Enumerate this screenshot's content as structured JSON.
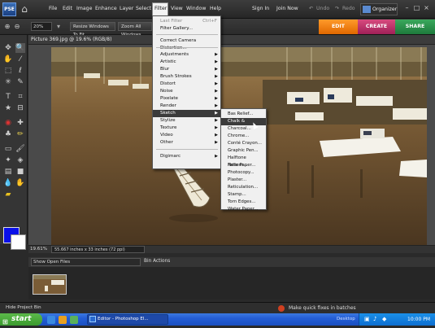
{
  "menubar": {
    "app_logo": "PSE",
    "menus": [
      "File",
      "Edit",
      "Image",
      "Enhance",
      "Layer",
      "Select",
      "Filter",
      "View",
      "Window",
      "Help"
    ],
    "sign_in": "Sign In",
    "join_now": "Join Now",
    "undo": "Undo",
    "redo": "Redo",
    "organizer": "Organizer"
  },
  "options_bar": {
    "zoom_value": "20%",
    "resize_windows": "Resize Windows To Fit",
    "zoom_all_windows": "Zoom All Windows"
  },
  "mode_tabs": {
    "edit": "EDIT",
    "create": "CREATE",
    "share": "SHARE",
    "colors": {
      "edit": "#f07a00",
      "create": "#c0306a",
      "share": "#2a8a4a"
    }
  },
  "document": {
    "title": "Picture 369.jpg @ 19.6% (RGB/8)",
    "zoom": "19.61%",
    "size_info": "55.667 inches x 33 inches (72 ppi)"
  },
  "filter_menu": {
    "items": [
      {
        "label": "Last Filter",
        "shortcut": "Ctrl+F",
        "disabled": true
      },
      {
        "label": "Filter Gallery..."
      },
      {
        "label": "Correct Camera Distortion..."
      },
      {
        "label": "Adjustments",
        "submenu": true
      },
      {
        "label": "Artistic",
        "submenu": true
      },
      {
        "label": "Blur",
        "submenu": true
      },
      {
        "label": "Brush Strokes",
        "submenu": true
      },
      {
        "label": "Distort",
        "submenu": true
      },
      {
        "label": "Noise",
        "submenu": true
      },
      {
        "label": "Pixelate",
        "submenu": true
      },
      {
        "label": "Render",
        "submenu": true
      },
      {
        "label": "Sketch",
        "submenu": true,
        "highlighted": true
      },
      {
        "label": "Stylize",
        "submenu": true
      },
      {
        "label": "Texture",
        "submenu": true
      },
      {
        "label": "Video",
        "submenu": true
      },
      {
        "label": "Other",
        "submenu": true
      },
      {
        "label": "Digimarc",
        "submenu": true
      }
    ]
  },
  "sketch_submenu": {
    "items": [
      "Bas Relief...",
      "Chalk & Charcoal...",
      "Charcoal...",
      "Chrome...",
      "Conté Crayon...",
      "Graphic Pen...",
      "Halftone Pattern...",
      "Note Paper...",
      "Photocopy...",
      "Plaster...",
      "Reticulation...",
      "Stamp...",
      "Torn Edges...",
      "Water Paper..."
    ],
    "highlighted_index": 1
  },
  "project_bin": {
    "select_label": "Show Open Files",
    "bin_actions": "Bin Actions",
    "hide_label": "Hide Project Bin",
    "quick_fix_hint": "Make quick fixes in batches"
  },
  "taskbar": {
    "start": "start",
    "task_item": "Editor - Photoshop El...",
    "desktop": "Desktop",
    "clock": "10:00 PM"
  }
}
